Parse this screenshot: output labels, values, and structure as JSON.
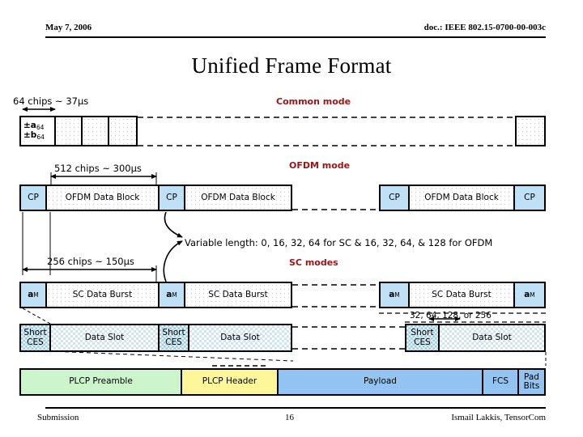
{
  "header": {
    "date": "May 7, 2006",
    "doc": "doc.: IEEE 802.15-0700-00-003c"
  },
  "title": "Unified Frame Format",
  "footer": {
    "left": "Submission",
    "page": "16",
    "right": "Ismail Lakkis, TensorCom"
  },
  "accent_color": "#9c1414",
  "annotations": {
    "chips64": "64 chips ~ 37µs",
    "chips512": "512 chips ~ 300µs",
    "chips256": "256 chips ~ 150µs",
    "variable_length": "Variable length: 0, 16, 32, 64 for SC & 16, 32, 64, & 128 for OFDM",
    "ces_lengths": "32, 64, 128, or 256"
  },
  "modes": {
    "common": "Common mode",
    "ofdm": "OFDM mode",
    "sc": "SC modes"
  },
  "rows": {
    "common": {
      "label_a": "±a",
      "label_a_sub": "64",
      "label_b": "±b",
      "label_b_sub": "64"
    },
    "ofdm": {
      "cp": "CP",
      "block": "OFDM Data Block"
    },
    "sc": {
      "am": "a",
      "am_sub": "M",
      "burst": "SC Data Burst"
    },
    "ces": {
      "short": "Short",
      "ces": "CES",
      "slot": "Data Slot"
    },
    "plcp": {
      "preamble": "PLCP Preamble",
      "header": "PLCP Header",
      "payload": "Payload",
      "fcs": "FCS",
      "pad1": "Pad",
      "pad2": "Bits"
    }
  }
}
